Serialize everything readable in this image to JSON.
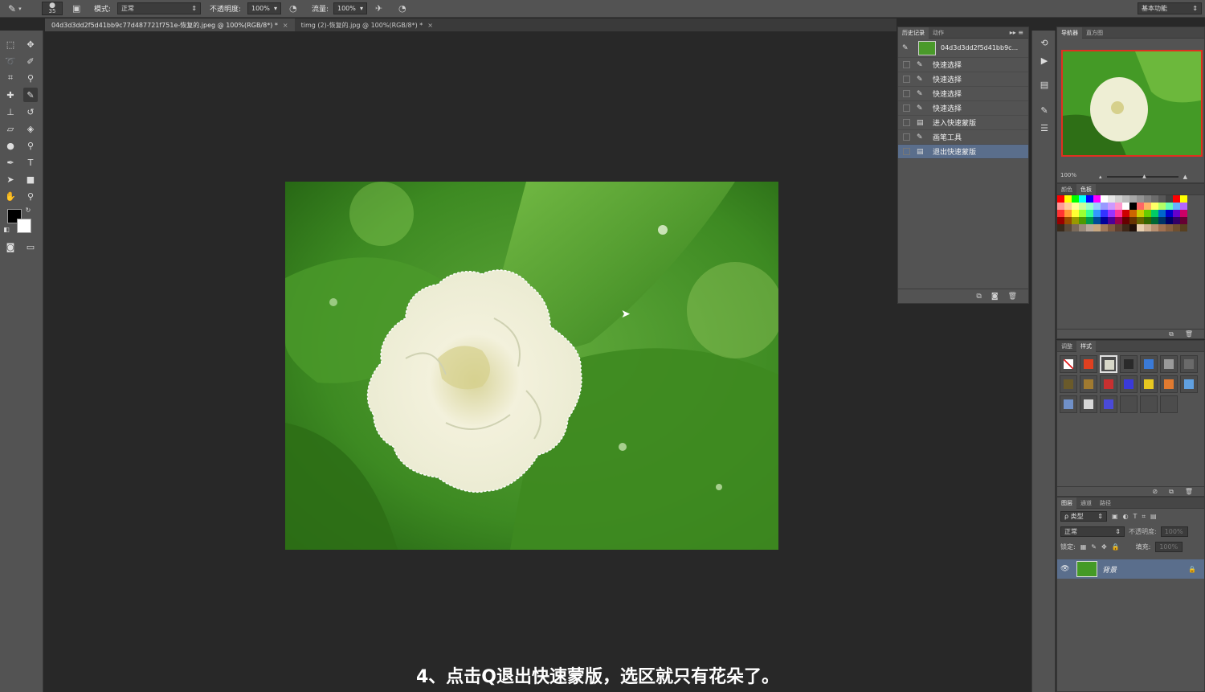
{
  "options_bar": {
    "brush_size": "35",
    "mode_label": "模式:",
    "mode_value": "正常",
    "opacity_label": "不透明度:",
    "opacity_value": "100%",
    "flow_label": "流量:",
    "flow_value": "100%",
    "workspace": "基本功能"
  },
  "tabs": [
    {
      "label": "04d3d3dd2f5d41bb9c77d487721f751e-恢复的.jpeg @ 100%(RGB/8*) *",
      "close": "×"
    },
    {
      "label": "timg (2)-恢复的.jpg @ 100%(RGB/8*) *",
      "close": "×"
    }
  ],
  "history_panel": {
    "tabs": [
      "历史记录",
      "动作"
    ],
    "snapshot_name": "04d3d3dd2f5d41bb9c...",
    "items": [
      {
        "label": "快速选择",
        "icon": "brush-icon"
      },
      {
        "label": "快速选择",
        "icon": "brush-icon"
      },
      {
        "label": "快速选择",
        "icon": "brush-icon"
      },
      {
        "label": "快速选择",
        "icon": "brush-icon"
      },
      {
        "label": "进入快速蒙版",
        "icon": "document-icon"
      },
      {
        "label": "画笔工具",
        "icon": "brush-icon"
      },
      {
        "label": "退出快速蒙版",
        "icon": "document-icon",
        "selected": true
      }
    ]
  },
  "navigator_panel": {
    "tabs": [
      "导航器",
      "直方图"
    ],
    "zoom": "100%"
  },
  "swatches_panel": {
    "tabs": [
      "颜色",
      "色板"
    ]
  },
  "styles_panel": {
    "tabs": [
      "调整",
      "样式"
    ]
  },
  "layers_panel": {
    "tabs": [
      "图层",
      "通道",
      "路径"
    ],
    "filter_label": "ρ 类型",
    "blend_mode": "正常",
    "opacity_label": "不透明度:",
    "opacity_value": "100%",
    "lock_label": "锁定:",
    "fill_label": "填充:",
    "fill_value": "100%",
    "layer_name": "背景"
  },
  "caption": "4、点击Q退出快速蒙版，选区就只有花朵了。",
  "colors": {
    "ui_bg": "#535353",
    "canvas_bg": "#282828",
    "selection": "#5a6e8c"
  }
}
